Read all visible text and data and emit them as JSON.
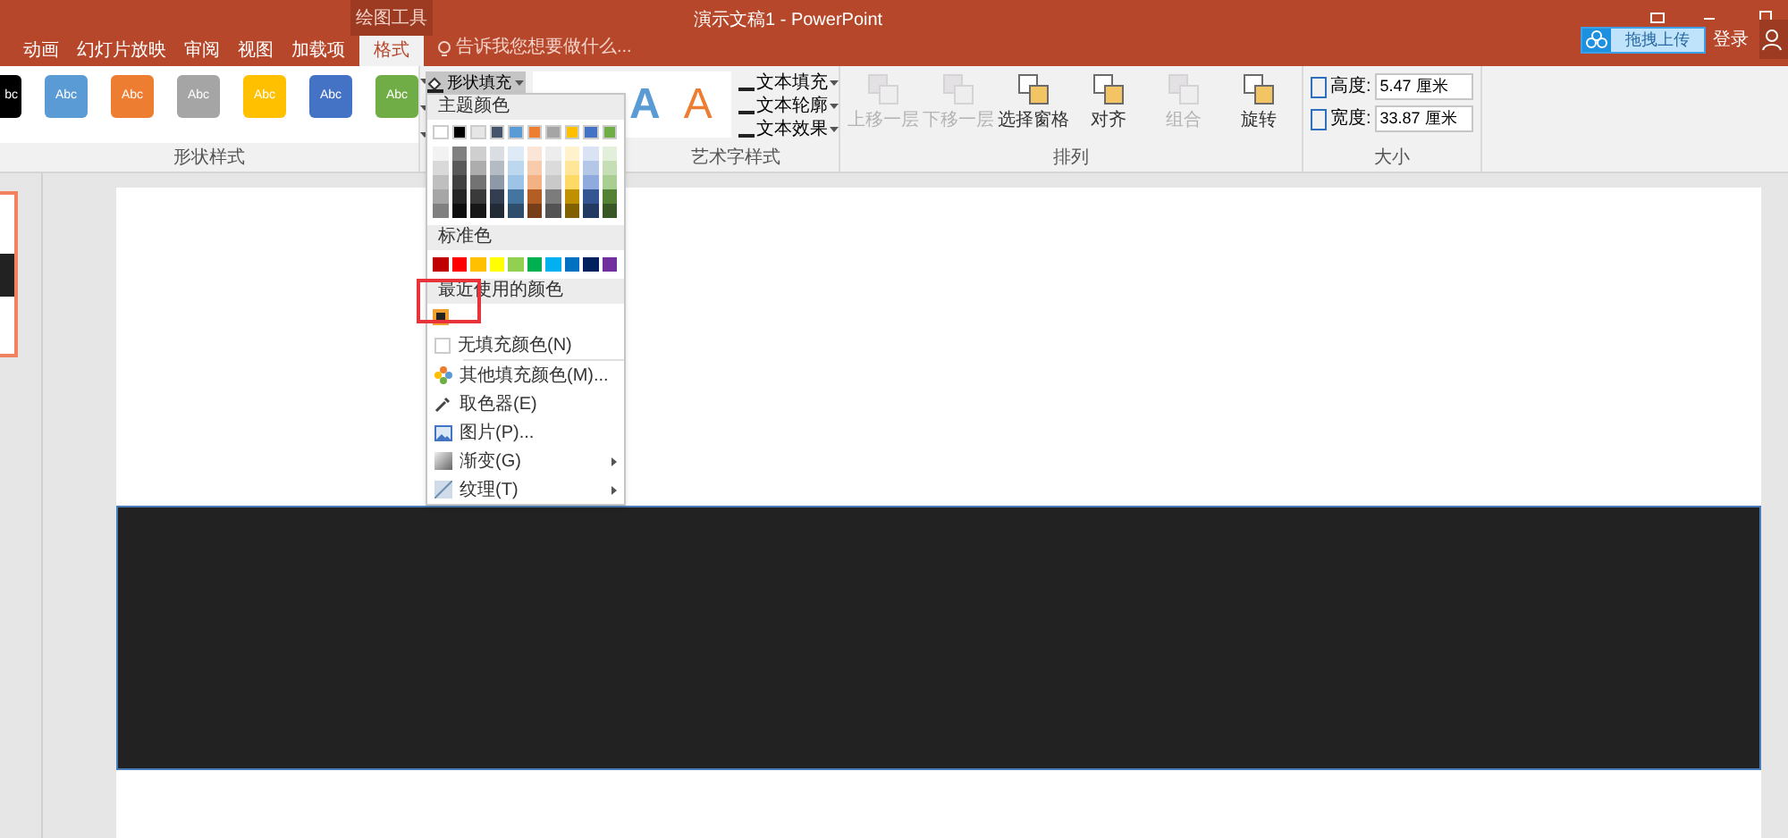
{
  "window": {
    "title": "演示文稿1 - PowerPoint",
    "context_label": "绘图工具",
    "upload_button": "拖拽上传",
    "sign_in": "登录"
  },
  "tabs": [
    {
      "label": "动画",
      "selected": false
    },
    {
      "label": "幻灯片放映",
      "selected": false
    },
    {
      "label": "审阅",
      "selected": false
    },
    {
      "label": "视图",
      "selected": false
    },
    {
      "label": "加载项",
      "selected": false
    },
    {
      "label": "格式",
      "selected": true
    }
  ],
  "tell_me": {
    "placeholder": "告诉我您想要做什么..."
  },
  "shape_styles": {
    "label": "形状样式",
    "swatches": [
      {
        "text": "bc",
        "color": "#000000"
      },
      {
        "text": "Abc",
        "color": "#5b9bd5"
      },
      {
        "text": "Abc",
        "color": "#ed7d31"
      },
      {
        "text": "Abc",
        "color": "#a5a5a5"
      },
      {
        "text": "Abc",
        "color": "#ffc000"
      },
      {
        "text": "Abc",
        "color": "#4472c4"
      },
      {
        "text": "Abc",
        "color": "#70ad47"
      }
    ]
  },
  "shape_fill": {
    "label": "形状填充",
    "expanded": true
  },
  "wordart": {
    "label": "艺术字样式",
    "samples": [
      {
        "text": "A",
        "kind": "fill",
        "color": "#5b9bd5"
      },
      {
        "text": "A",
        "kind": "outline",
        "color": "#ed7d31"
      }
    ],
    "buttons": [
      "文本填充",
      "文本轮廓",
      "文本效果"
    ]
  },
  "arrange": {
    "label": "排列",
    "buttons": [
      {
        "label": "上移一层",
        "disabled": true
      },
      {
        "label": "下移一层",
        "disabled": true
      },
      {
        "label": "选择窗格",
        "disabled": false
      },
      {
        "label": "对齐",
        "disabled": false
      },
      {
        "label": "组合",
        "disabled": true
      },
      {
        "label": "旋转",
        "disabled": false
      }
    ]
  },
  "size": {
    "label": "大小",
    "fields": [
      {
        "label": "高度:",
        "value": "5.47 厘米"
      },
      {
        "label": "宽度:",
        "value": "33.87 厘米"
      }
    ]
  },
  "fill_menu": {
    "theme_header": "主题颜色",
    "theme_colors": [
      {
        "color": "#ffffff"
      },
      {
        "color": "#000000"
      },
      {
        "color": "#e7e6e6"
      },
      {
        "color": "#44546a"
      },
      {
        "color": "#5b9bd5"
      },
      {
        "color": "#ed7d31"
      },
      {
        "color": "#a5a5a5"
      },
      {
        "color": "#ffc000"
      },
      {
        "color": "#4472c4"
      },
      {
        "color": "#70ad47"
      }
    ],
    "standard_header": "标准色",
    "standard_colors": [
      {
        "color": "#c00000"
      },
      {
        "color": "#ff0000"
      },
      {
        "color": "#ffc000"
      },
      {
        "color": "#ffff00"
      },
      {
        "color": "#92d050"
      },
      {
        "color": "#00b050"
      },
      {
        "color": "#00b0f0"
      },
      {
        "color": "#0070c0"
      },
      {
        "color": "#002060"
      },
      {
        "color": "#7030a0"
      }
    ],
    "recent_header": "最近使用的颜色",
    "recent_colors": [
      {
        "color": "#222222",
        "selected": true
      }
    ],
    "items": [
      {
        "kind": "none",
        "label": "无填充颜色(N)",
        "submenu": false
      },
      {
        "kind": "more",
        "label": "其他填充颜色(M)...",
        "submenu": false
      },
      {
        "kind": "eyedropper",
        "label": "取色器(E)",
        "submenu": false
      },
      {
        "kind": "picture",
        "label": "图片(P)...",
        "submenu": false
      },
      {
        "kind": "gradient",
        "label": "渐变(G)",
        "submenu": true
      },
      {
        "kind": "texture",
        "label": "纹理(T)",
        "submenu": true
      }
    ]
  }
}
